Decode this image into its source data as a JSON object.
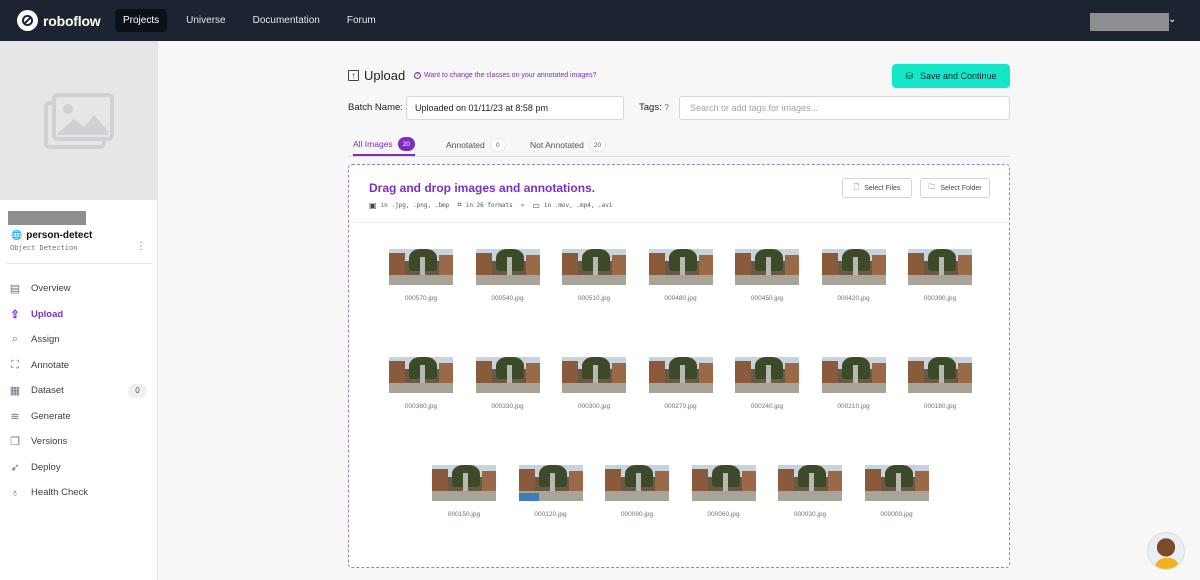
{
  "nav": {
    "brand": "roboflow",
    "items": [
      {
        "label": "Projects",
        "active": true
      },
      {
        "label": "Universe",
        "active": false
      },
      {
        "label": "Documentation",
        "active": false
      },
      {
        "label": "Forum",
        "active": false
      }
    ],
    "user_chevron": "⌄"
  },
  "sidebar": {
    "project_name": "person-detect",
    "project_type": "Object Detection",
    "items": [
      {
        "label": "Overview",
        "icon": "document-icon"
      },
      {
        "label": "Upload",
        "icon": "upload-icon",
        "active": true
      },
      {
        "label": "Assign",
        "icon": "search-icon"
      },
      {
        "label": "Annotate",
        "icon": "annotate-icon"
      },
      {
        "label": "Dataset",
        "icon": "images-icon",
        "badge": "0"
      },
      {
        "label": "Generate",
        "icon": "layers-icon"
      },
      {
        "label": "Versions",
        "icon": "versions-icon"
      },
      {
        "label": "Deploy",
        "icon": "rocket-icon"
      },
      {
        "label": "Health Check",
        "icon": "stethoscope-icon"
      }
    ]
  },
  "upload": {
    "title": "Upload",
    "help_link": "Want to change the classes on your annotated images?",
    "save_button": "Save and Continue",
    "batch_label": "Batch Name:",
    "batch_value": "Uploaded on 01/11/23 at 8:58 pm",
    "tags_label": "Tags:",
    "tags_help": "?",
    "tags_placeholder": "Search or add tags for images..."
  },
  "tabs": [
    {
      "label": "All Images",
      "count": "20",
      "active": true
    },
    {
      "label": "Annotated",
      "count": "0",
      "active": false
    },
    {
      "label": "Not Annotated",
      "count": "20",
      "active": false
    }
  ],
  "dropzone": {
    "title": "Drag and drop images and annotations.",
    "formats": [
      "in .jpg, .png, .bmp",
      "in 26 formats",
      "in .mov, .mp4, .avi"
    ],
    "format_separator": "»",
    "select_files": "Select Files",
    "select_folder": "Select Folder"
  },
  "images": [
    "000570.jpg",
    "000540.jpg",
    "000510.jpg",
    "000480.jpg",
    "000450.jpg",
    "000420.jpg",
    "000390.jpg",
    "000360.jpg",
    "000330.jpg",
    "000300.jpg",
    "000270.jpg",
    "000240.jpg",
    "000210.jpg",
    "000180.jpg",
    "000150.jpg",
    "000120.jpg",
    "000090.jpg",
    "000060.jpg",
    "000030.jpg",
    "000000.jpg"
  ],
  "colors": {
    "accent": "#7b2fbf",
    "save_button": "#14e6c8",
    "nav_bg": "#1b2430"
  }
}
